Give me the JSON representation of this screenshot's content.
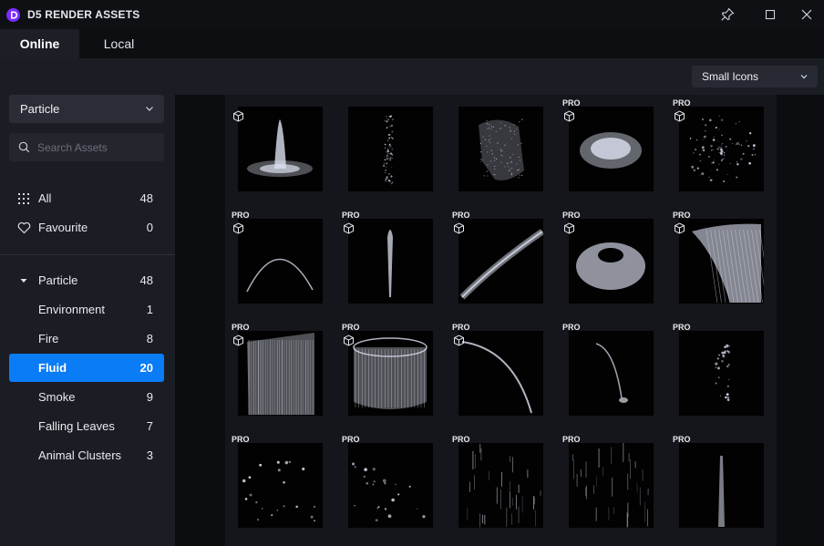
{
  "app": {
    "title": "D5 RENDER ASSETS",
    "logo_letter": "D"
  },
  "tabs": [
    {
      "label": "Online",
      "active": true
    },
    {
      "label": "Local",
      "active": false
    }
  ],
  "toolbar": {
    "view_mode": "Small Icons"
  },
  "sidebar": {
    "category_dropdown": "Particle",
    "search_placeholder": "Search Assets",
    "top_items": [
      {
        "label": "All",
        "count": "48",
        "icon": "grid-icon"
      },
      {
        "label": "Favourite",
        "count": "0",
        "icon": "heart-icon"
      }
    ],
    "group": {
      "label": "Particle",
      "count": "48",
      "expanded": true
    },
    "sub_items": [
      {
        "label": "Environment",
        "count": "1",
        "active": false
      },
      {
        "label": "Fire",
        "count": "8",
        "active": false
      },
      {
        "label": "Fluid",
        "count": "20",
        "active": true
      },
      {
        "label": "Smoke",
        "count": "9",
        "active": false
      },
      {
        "label": "Falling Leaves",
        "count": "7",
        "active": false
      },
      {
        "label": "Animal Clusters",
        "count": "3",
        "active": false
      }
    ]
  },
  "assets": {
    "pro_badge": "PRO",
    "items": [
      {
        "pro": false,
        "model": true,
        "thumb": "fountain"
      },
      {
        "pro": false,
        "model": false,
        "thumb": "spray-column"
      },
      {
        "pro": false,
        "model": false,
        "thumb": "mist-sheet"
      },
      {
        "pro": true,
        "model": true,
        "thumb": "splash-ring"
      },
      {
        "pro": true,
        "model": true,
        "thumb": "burst"
      },
      {
        "pro": true,
        "model": true,
        "thumb": "arc-jet"
      },
      {
        "pro": true,
        "model": true,
        "thumb": "vertical-jet"
      },
      {
        "pro": true,
        "model": true,
        "thumb": "diagonal-spray"
      },
      {
        "pro": true,
        "model": true,
        "thumb": "water-ring"
      },
      {
        "pro": true,
        "model": true,
        "thumb": "waterfall"
      },
      {
        "pro": true,
        "model": true,
        "thumb": "curtain"
      },
      {
        "pro": true,
        "model": true,
        "thumb": "cylinder-curtain"
      },
      {
        "pro": true,
        "model": true,
        "thumb": "high-arc"
      },
      {
        "pro": true,
        "model": false,
        "thumb": "drip-arc"
      },
      {
        "pro": true,
        "model": false,
        "thumb": "droplets"
      },
      {
        "pro": true,
        "model": false,
        "thumb": "scatter-drops"
      },
      {
        "pro": true,
        "model": false,
        "thumb": "sparse-drops"
      },
      {
        "pro": true,
        "model": false,
        "thumb": "rain-streaks"
      },
      {
        "pro": true,
        "model": false,
        "thumb": "rain-light"
      },
      {
        "pro": true,
        "model": false,
        "thumb": "thin-stream"
      }
    ]
  }
}
